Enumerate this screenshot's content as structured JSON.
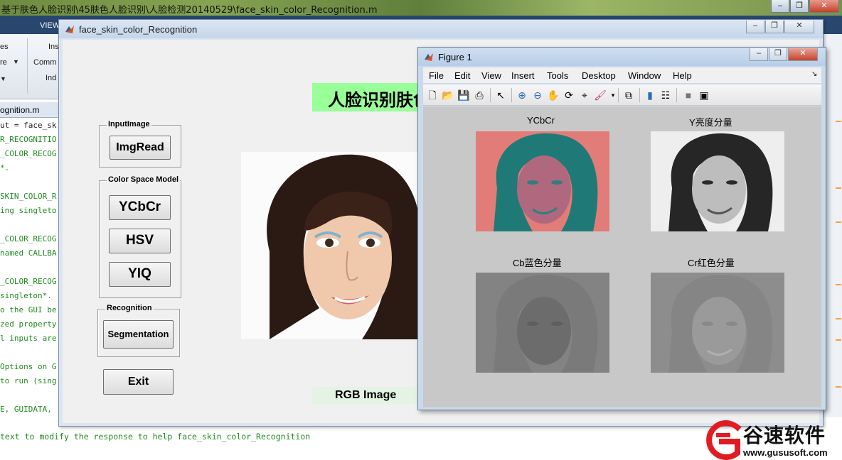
{
  "matlab": {
    "title": "基于肤色人脸识别\\45肤色人脸识别\\人脸检测20140529\\face_skin_color_Recognition.m",
    "tabs": [
      "VIEW"
    ],
    "ribbon_texts": [
      "es",
      "Ins",
      "re",
      "Comm",
      "Ind"
    ],
    "editor_tab": "ognition.m",
    "code_lines": [
      "ut = face_sk",
      "R_RECOGNITIO",
      "_COLOR_RECOG",
      "*.",
      "",
      "SKIN_COLOR_R",
      "ing singleto",
      "",
      "_COLOR_RECOG",
      "named CALLBA",
      "",
      "_COLOR_RECOG",
      "singleton*.",
      "o the GUI be",
      "zed property",
      "l inputs are",
      "",
      "Options on G",
      "to run (sing",
      "",
      "E, GUIDATA,"
    ],
    "status_line": " text to modify the response to help face_skin_color_Recognition"
  },
  "gui": {
    "title": "face_skin_color_Recognition",
    "heading": "人脸识别肤色",
    "panels": {
      "input": {
        "title": "InputImage",
        "button": "ImgRead"
      },
      "color_space": {
        "title": "Color Space Model",
        "buttons": [
          "YCbCr",
          "HSV",
          "YIQ"
        ]
      },
      "recognition": {
        "title": "Recognition",
        "button": "Segmentation"
      }
    },
    "exit_button": "Exit",
    "rgb_label": "RGB Image"
  },
  "figure": {
    "title": "Figure 1",
    "menu": [
      "File",
      "Edit",
      "View",
      "Insert",
      "Tools",
      "Desktop",
      "Window",
      "Help"
    ],
    "axes": [
      {
        "title": "YCbCr"
      },
      {
        "title": "Y亮度分量"
      },
      {
        "title": "Cb蓝色分量"
      },
      {
        "title": "Cr红色分量"
      }
    ]
  },
  "watermark": {
    "brand": "谷速软件",
    "url": "www.gususoft.com"
  },
  "colors": {
    "heading_bg": "#99ff99",
    "rgb_label_bg": "#e4f3e4",
    "ribbon_tab_bg": "#28466e",
    "figure_bg": "#c8c8c8"
  }
}
